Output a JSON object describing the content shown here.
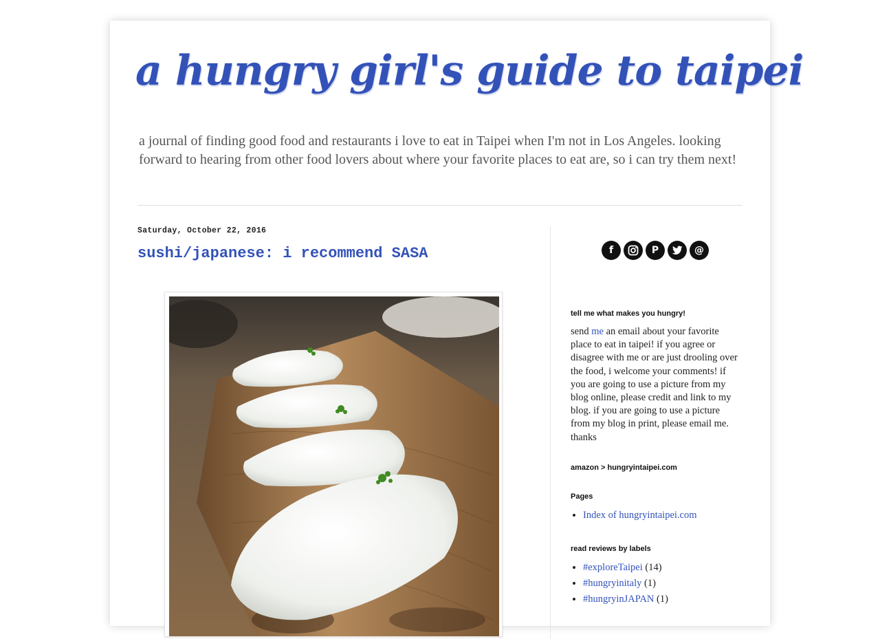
{
  "blog": {
    "title": "a hungry girl's guide to taipei",
    "description": "a journal of finding good food and restaurants i love to eat in Taipei when I'm not in Los Angeles. looking forward to hearing from other food lovers about where your favorite places to eat are, so i can try them next!"
  },
  "post": {
    "date": "Saturday, October 22, 2016",
    "title": "sushi/japanese: i recommend SASA"
  },
  "sidebar": {
    "social": [
      {
        "icon": "facebook-icon",
        "glyph": "f"
      },
      {
        "icon": "instagram-icon",
        "glyph": ""
      },
      {
        "icon": "pinterest-icon",
        "glyph": "P"
      },
      {
        "icon": "twitter-icon",
        "glyph": ""
      },
      {
        "icon": "email-icon",
        "glyph": "@"
      }
    ],
    "hungry_widget": {
      "title": "tell me what makes you hungry!",
      "text_before": "send ",
      "link": "me",
      "text_after": " an email about your favorite place to eat in taipei! if you agree or disagree with me or are just drooling over the food, i welcome your comments! if you are going to use a picture from my blog online, please credit and link to my blog. if you are going to use a picture from my blog in print, please email me. thanks"
    },
    "amazon_title": "amazon > hungryintaipei.com",
    "pages": {
      "title": "Pages",
      "items": [
        "Index of hungryintaipei.com"
      ]
    },
    "labels": {
      "title": "read reviews by labels",
      "items": [
        {
          "label": "#exploreTaipei",
          "count": "(14)"
        },
        {
          "label": "#hungryinitaly",
          "count": "(1)"
        },
        {
          "label": "#hungryinJAPAN",
          "count": "(1)"
        }
      ]
    }
  },
  "colors": {
    "accent": "#3352b8",
    "text": "#222222",
    "muted": "#555555"
  }
}
